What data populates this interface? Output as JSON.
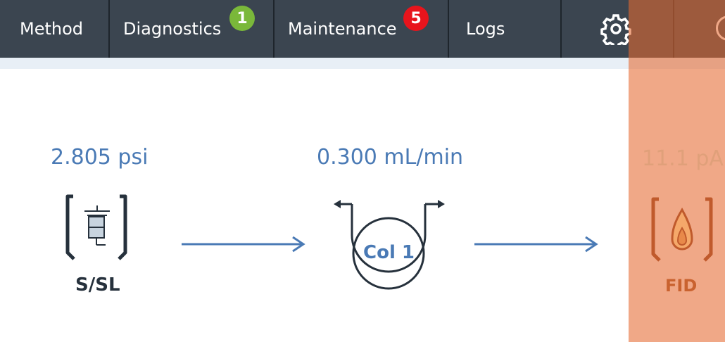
{
  "nav": {
    "tabs": [
      {
        "label": "Method"
      },
      {
        "label": "Diagnostics",
        "badge": "1",
        "badge_color": "#7ab83a"
      },
      {
        "label": "Maintenance",
        "badge": "5",
        "badge_color": "#e8141c"
      },
      {
        "label": "Logs"
      }
    ],
    "settings_icon": "gear-icon"
  },
  "flow": {
    "inlet": {
      "value": "2.805 psi",
      "label": "S/SL",
      "icon": "inlet-icon"
    },
    "column": {
      "value": "0.300 mL/min",
      "label": "Col 1",
      "icon": "column-coil-icon"
    },
    "detector": {
      "value": "11.1 pA",
      "label": "FID",
      "icon": "flame-icon"
    }
  },
  "colors": {
    "header_bg": "#3b4550",
    "accent_blue": "#4a7ab5",
    "detector_highlight": "#e66930"
  }
}
